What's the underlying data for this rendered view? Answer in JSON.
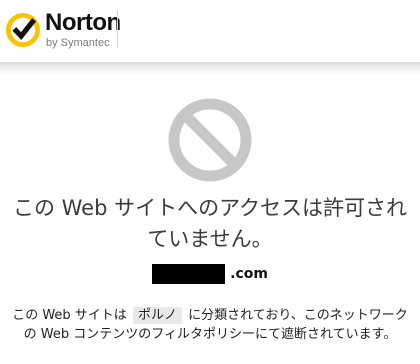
{
  "header": {
    "brand_name": "Norton",
    "brand_subtitle": "by Symantec",
    "brand_colors": {
      "yellow": "#F7C400",
      "check": "#111111"
    },
    "logo_icon": "check-badge-icon"
  },
  "main": {
    "status_icon": "blocked-icon",
    "status_icon_color": "#C7C7C7",
    "headline": "この Web サイトへのアクセスは許可されていません。",
    "domain_suffix": ".com",
    "description": {
      "prefix": "この Web サイトは ",
      "category": "ポルノ",
      "suffix": " に分類されており、このネットワークの Web コンテンツのフィルタポリシーにて遮断されています。"
    }
  }
}
